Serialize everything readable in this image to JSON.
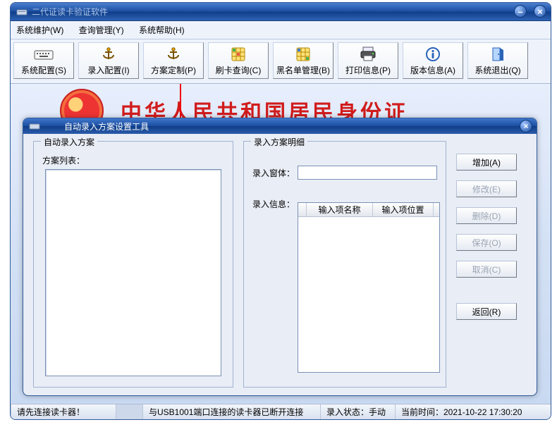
{
  "app": {
    "title": "二代证读卡验证软件"
  },
  "menu": {
    "maintain": "系统维护(W)",
    "query": "查询管理(Y)",
    "help": "系统帮助(H)"
  },
  "toolbar": {
    "items": [
      {
        "label": "系统配置(S)",
        "icon": "keyboard"
      },
      {
        "label": "录入配置(I)",
        "icon": "anchor"
      },
      {
        "label": "方案定制(P)",
        "icon": "anchor"
      },
      {
        "label": "刷卡查询(C)",
        "icon": "grid"
      },
      {
        "label": "黑名单管理(B)",
        "icon": "grid2"
      },
      {
        "label": "打印信息(P)",
        "icon": "printer"
      },
      {
        "label": "版本信息(A)",
        "icon": "info"
      },
      {
        "label": "系统退出(Q)",
        "icon": "door"
      }
    ]
  },
  "banner": {
    "text": "中华人民共和国居民身份证"
  },
  "dialog": {
    "title": "自动录入方案设置工具",
    "left": {
      "legend": "自动录入方案",
      "list_label": "方案列表："
    },
    "right": {
      "legend": "录入方案明细",
      "window_label": "录入窗体：",
      "window_value": "",
      "info_label": "录入信息：",
      "col1": "输入项名称",
      "col2": "输入项位置"
    },
    "buttons": {
      "add": "增加(A)",
      "edit": "修改(E)",
      "del": "删除(D)",
      "save": "保存(O)",
      "cancel": "取消(C)",
      "back": "返回(R)"
    }
  },
  "status": {
    "connect": "请先连接读卡器！",
    "usb": "与USB1001端口连接的读卡器已断开连接",
    "mode": "录入状态：手动",
    "time": "当前时间：2021-10-22 17:30:20"
  }
}
